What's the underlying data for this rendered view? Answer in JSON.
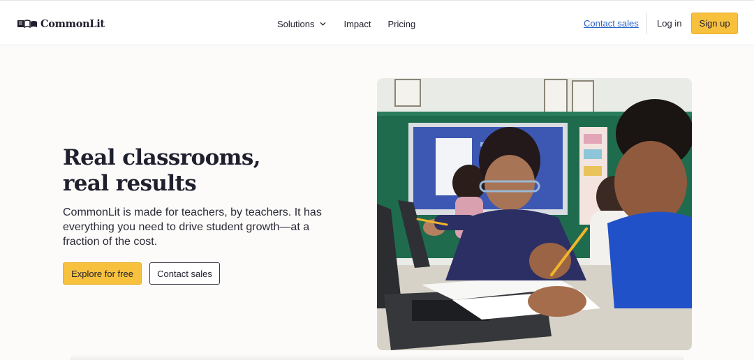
{
  "header": {
    "logo_text": "CommonLit",
    "nav": [
      {
        "label": "Solutions",
        "has_dropdown": true
      },
      {
        "label": "Impact"
      },
      {
        "label": "Pricing"
      }
    ],
    "contact_sales": "Contact sales",
    "login": "Log in",
    "signup": "Sign up"
  },
  "hero": {
    "title_line1": "Real classrooms,",
    "title_line2": "real results",
    "body": "CommonLit is made for teachers, by teachers. It has everything you need to drive student growth—at a fraction of the cost.",
    "explore_button": "Explore for free",
    "contact_button": "Contact sales"
  },
  "colors": {
    "accent": "#f8c13d",
    "link": "#2563c9",
    "background": "#fcfbf9",
    "text": "#1f1f2e"
  },
  "icons": {
    "logo": "book-logo-icon",
    "dropdown": "chevron-down-icon"
  }
}
